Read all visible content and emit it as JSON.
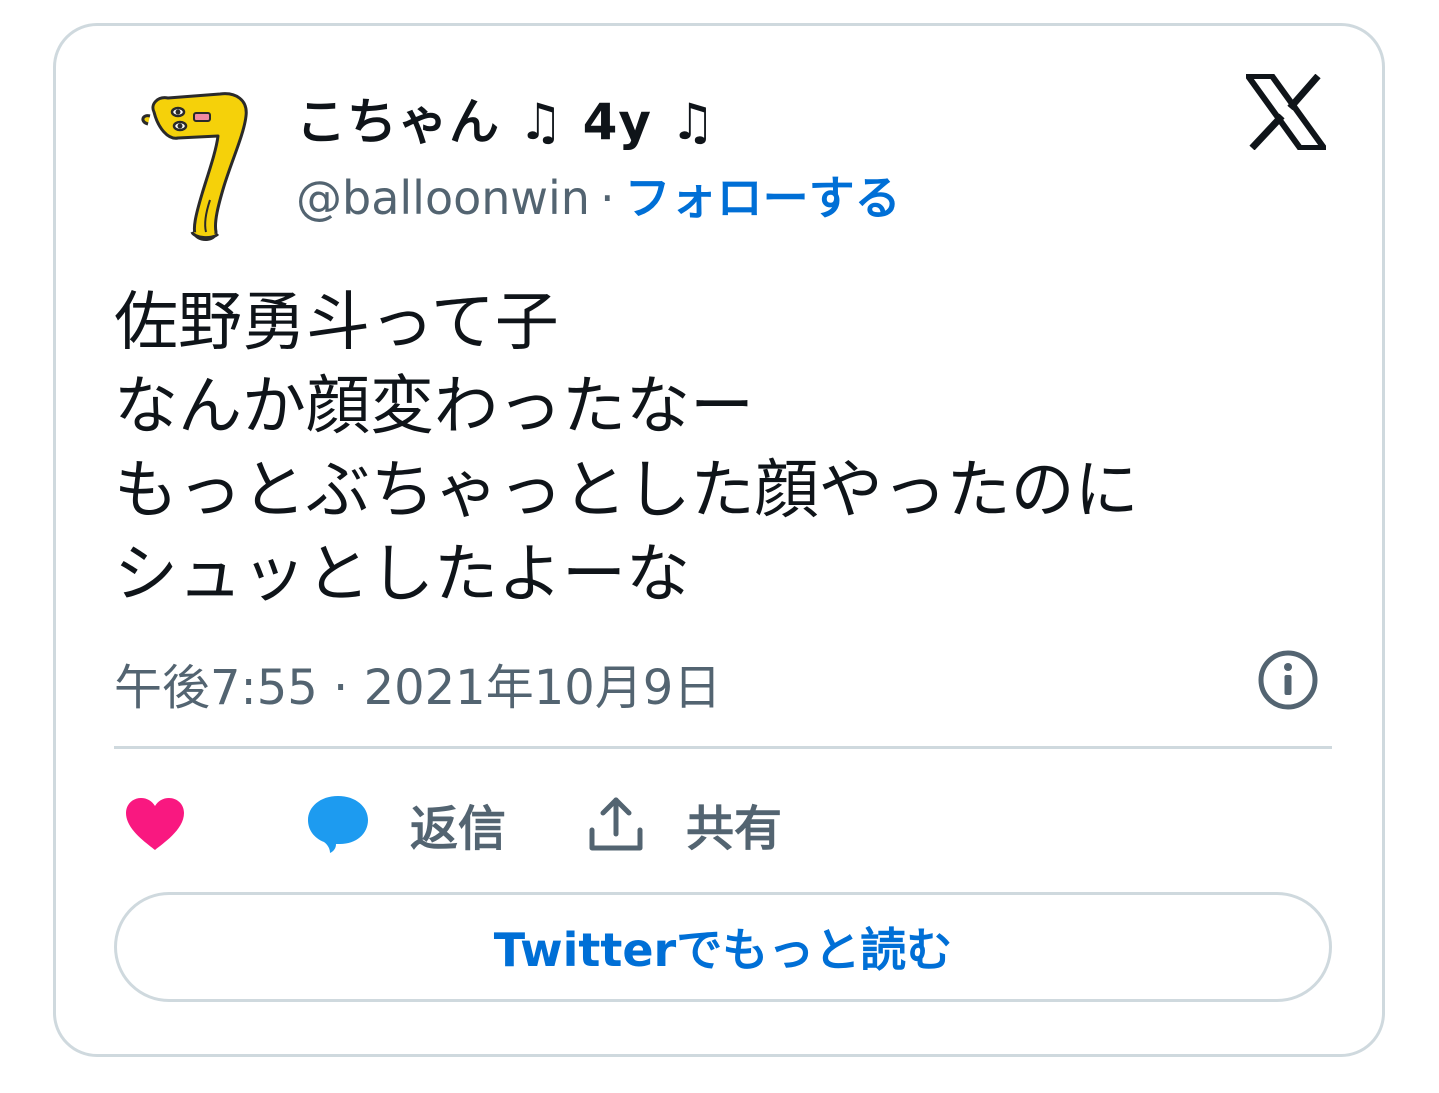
{
  "author": {
    "display_name": "こちゃん ♫ 4y ♫",
    "handle": "@balloonwin",
    "separator": "·",
    "follow_label": "フォローする"
  },
  "tweet": {
    "lines": [
      "佐野勇斗って子",
      "なんか顔変わったなー",
      "もっとぶちゃっとした顔やったのに",
      "シュッとしたよーな"
    ],
    "timestamp": "午後7:55 · 2021年10月9日"
  },
  "actions": {
    "like_icon": "heart-icon",
    "reply_label": "返信",
    "share_label": "共有"
  },
  "more_button_label": "Twitterでもっと読む",
  "colors": {
    "accent": "#006fd6",
    "like": "#f91880",
    "reply_icon": "#1d9bf0",
    "secondary_text": "#536471",
    "border": "#cfd9de"
  },
  "icons": {
    "avatar": "yellow-seven-character-avatar",
    "logo": "x-logo-icon",
    "info": "info-icon",
    "reply": "speech-bubble-icon",
    "share": "share-upload-icon"
  }
}
